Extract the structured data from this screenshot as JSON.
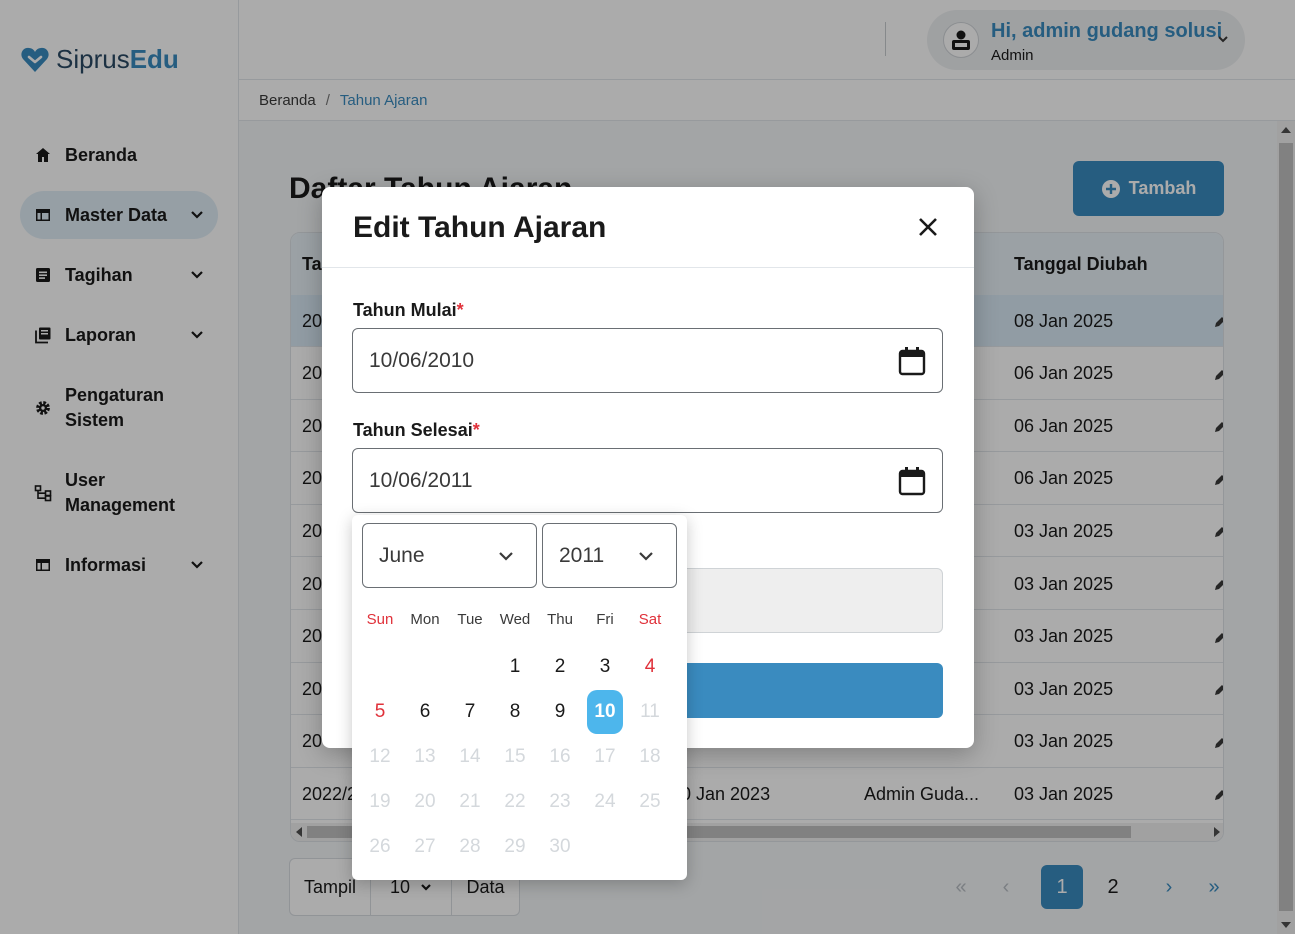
{
  "logo": {
    "part1": "Siprus",
    "part2": "Edu"
  },
  "sidebar": {
    "items": [
      {
        "label": "Beranda",
        "icon": "home-icon"
      },
      {
        "label": "Master Data",
        "icon": "table-icon"
      },
      {
        "label": "Tagihan",
        "icon": "list-icon"
      },
      {
        "label": "Laporan",
        "icon": "report-icon"
      },
      {
        "label": "Pengaturan Sistem",
        "line1": "Pengaturan",
        "line2": "Sistem",
        "icon": "gear-icon"
      },
      {
        "label": "User Management",
        "line1": "User",
        "line2": "Management",
        "icon": "hierarchy-icon"
      },
      {
        "label": "Informasi",
        "icon": "table-icon"
      }
    ]
  },
  "header": {
    "user_greeting": "Hi, admin gudang solusi",
    "user_role": "Admin"
  },
  "breadcrumb": {
    "home": "Beranda",
    "separator": "/",
    "current": "Tahun Ajaran"
  },
  "page": {
    "title": "Daftar Tahun Ajaran",
    "add_button": "Tambah"
  },
  "table": {
    "col_first_visible": "Ta",
    "col_last_visible": "Tanggal Diubah",
    "rows": [
      {
        "c1": "20",
        "modified": "08 Jan 2025"
      },
      {
        "c1": "20",
        "modified": "06 Jan 2025"
      },
      {
        "c1": "20",
        "modified": "06 Jan 2025"
      },
      {
        "c1": "20",
        "modified": "06 Jan 2025"
      },
      {
        "c1": "20",
        "modified": "03 Jan 2025"
      },
      {
        "c1": "20",
        "modified": "03 Jan 2025"
      },
      {
        "c1": "20",
        "modified": "03 Jan 2025"
      },
      {
        "c1": "20",
        "modified": "03 Jan 2025"
      },
      {
        "c1": "20",
        "modified": "03 Jan 2025"
      },
      {
        "c1": "2022/2",
        "created": "0 Jan 2023",
        "creator": "Admin Guda...",
        "modified": "03 Jan 2025"
      }
    ]
  },
  "footer": {
    "show_label": "Tampil",
    "per_page": "10",
    "data_label": "Data",
    "pages": [
      "1",
      "2"
    ],
    "current_page": "1"
  },
  "modal": {
    "title": "Edit Tahun Ajaran",
    "start_label": "Tahun Mulai",
    "start_value": "10/06/2010",
    "end_label": "Tahun Selesai",
    "end_value": "10/06/2011",
    "required_mark": "*"
  },
  "datepicker": {
    "month": "June",
    "year": "2011",
    "weekdays": [
      "Sun",
      "Mon",
      "Tue",
      "Wed",
      "Thu",
      "Fri",
      "Sat"
    ],
    "selected_day": 10,
    "days": [
      [
        "",
        "",
        "",
        "1",
        "2",
        "3",
        "4"
      ],
      [
        "5",
        "6",
        "7",
        "8",
        "9",
        "10",
        "11"
      ],
      [
        "12",
        "13",
        "14",
        "15",
        "16",
        "17",
        "18"
      ],
      [
        "19",
        "20",
        "21",
        "22",
        "23",
        "24",
        "25"
      ],
      [
        "26",
        "27",
        "28",
        "29",
        "30",
        "",
        ""
      ]
    ]
  },
  "colors": {
    "primary": "#3a8bbf",
    "selected_day": "#4db6ec",
    "weekend": "#e0313a"
  }
}
